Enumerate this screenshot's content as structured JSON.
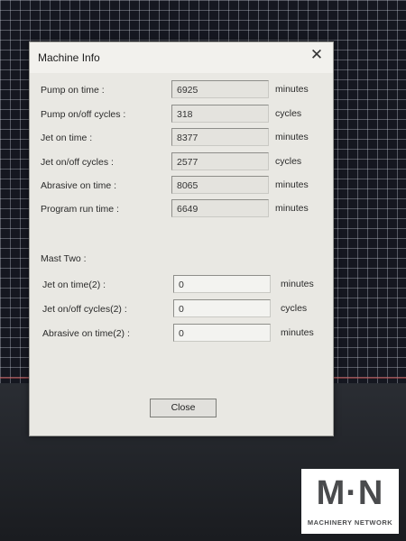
{
  "dialog": {
    "title": "Machine Info",
    "close_icon": "close-icon",
    "rows": [
      {
        "label": "Pump on time :",
        "value": "6925",
        "unit": "minutes"
      },
      {
        "label": "Pump on/off cycles :",
        "value": "318",
        "unit": "cycles"
      },
      {
        "label": "Jet on time :",
        "value": "8377",
        "unit": "minutes"
      },
      {
        "label": "Jet on/off cycles :",
        "value": "2577",
        "unit": "cycles"
      },
      {
        "label": "Abrasive on time :",
        "value": "8065",
        "unit": "minutes"
      },
      {
        "label": "Program run time :",
        "value": "6649",
        "unit": "minutes"
      }
    ],
    "section_title": "Mast Two :",
    "mast_rows": [
      {
        "label": "Jet on time(2) :",
        "value": "0",
        "unit": "minutes"
      },
      {
        "label": "Jet on/off cycles(2) :",
        "value": "0",
        "unit": "cycles"
      },
      {
        "label": "Abrasive on time(2) :",
        "value": "0",
        "unit": "minutes"
      }
    ],
    "close_button": "Close"
  },
  "watermark": {
    "mark": "M·N",
    "text": "MACHINERY NETWORK"
  }
}
